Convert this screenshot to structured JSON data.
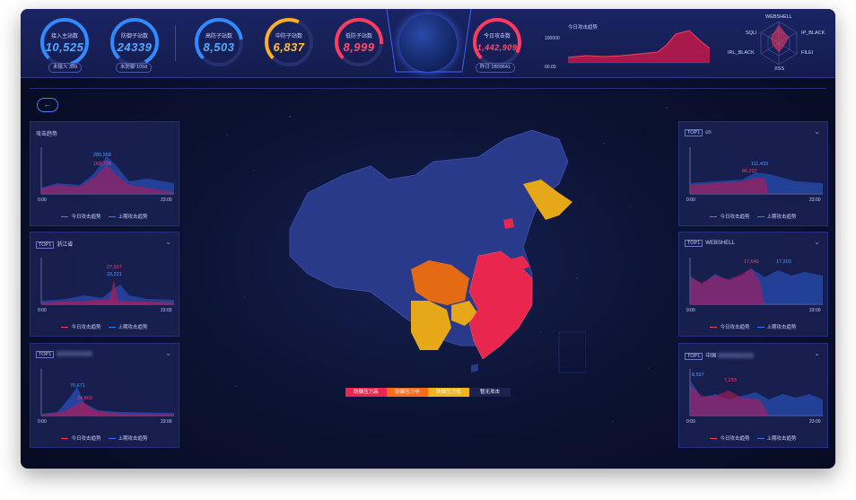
{
  "header": {
    "gauges": [
      {
        "label": "接入主站数",
        "value": "10,525",
        "color": "#2f8bff",
        "sub": "未接入 389"
      },
      {
        "label": "防御子站数",
        "value": "24339",
        "color": "#2f8bff",
        "sub": "未防御 1058"
      },
      {
        "label": "高防子站数",
        "value": "8,503",
        "color": "#2f8bff",
        "sub": ""
      },
      {
        "label": "中防子站数",
        "value": "6,837",
        "color": "#ffb020",
        "sub": ""
      },
      {
        "label": "低防子站数",
        "value": "8,999",
        "color": "#ff3c60",
        "sub": ""
      },
      {
        "label": "今日攻击数",
        "value": "1,442,909",
        "color": "#ff3c60",
        "sub": "昨日 2809641"
      }
    ],
    "trend": {
      "title": "今日攻击趋势",
      "ymax": "100000",
      "ymin": "00.00"
    },
    "radar": {
      "labels": [
        "WEBSHELL",
        "IP_BLACK",
        "FILEI",
        "XSS",
        "IRL_BLACK",
        "SQLI"
      ]
    }
  },
  "left_panels": [
    {
      "title": "攻击趋势",
      "top1": "",
      "peak_blue": "285,558",
      "peak_red": "168,728",
      "x_start": "0:00",
      "x_end": "23:00"
    },
    {
      "title": "浙江省",
      "top1": "TOP1",
      "peak_blue": "20,221",
      "peak_red": "27,927",
      "x_start": "0:00",
      "x_end": "23:00"
    },
    {
      "title": "",
      "top1": "TOP1",
      "peak_blue": "70,671",
      "peak_red": "24,860",
      "x_start": "0:00",
      "x_end": "23:00"
    }
  ],
  "right_panels": [
    {
      "title": "cn",
      "top1": "TOP1",
      "peak_blue": "111,433",
      "peak_red": "86,237",
      "x_start": "0:00",
      "x_end": "23:00"
    },
    {
      "title": "WEBSHELL",
      "top1": "TOP1",
      "peak_blue": "17,203",
      "peak_red": "17,646",
      "x_start": "0:00",
      "x_end": "23:00"
    },
    {
      "title": "中国",
      "top1": "TOP1",
      "peak_blue": "8,597",
      "peak_red": "7,233",
      "x_start": "0:00",
      "x_end": "23:00"
    }
  ],
  "legend_labels": {
    "today": "今日攻击趋势",
    "last": "上期攻击趋势"
  },
  "map_legend": [
    {
      "label": "防御压力高",
      "color": "#e8264e"
    },
    {
      "label": "防御压力中",
      "color": "#ff6a1a"
    },
    {
      "label": "防御压力低",
      "color": "#f0b51c"
    },
    {
      "label": "暂无攻击",
      "color": "#1a2350"
    }
  ],
  "back_icon": "arrow-left-icon"
}
